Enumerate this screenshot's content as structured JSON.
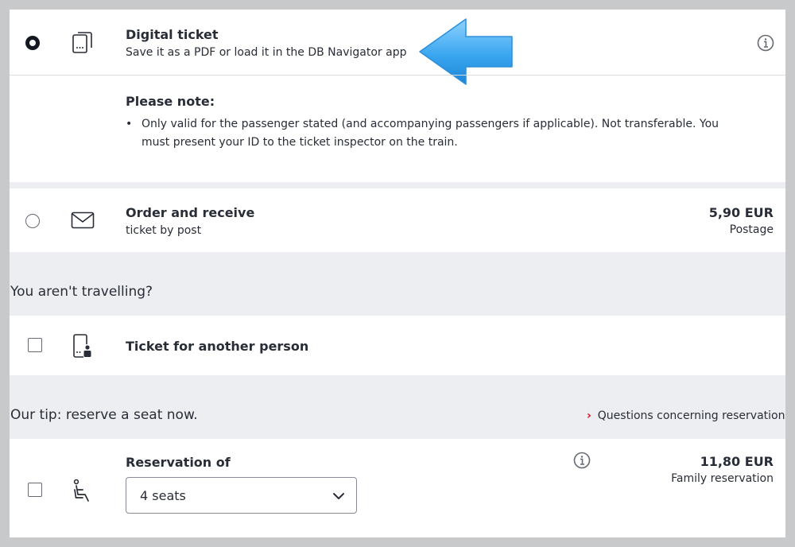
{
  "digital_ticket": {
    "title": "Digital ticket",
    "subtitle": "Save it as a PDF or load it in the DB Navigator app",
    "selected": true,
    "icon": "mobile-ticket-icon"
  },
  "note": {
    "heading": "Please note:",
    "items": [
      "Only valid for the passenger stated (and accompanying passengers if applicable). Not transferable. You must present your ID to the ticket inspector on the train."
    ]
  },
  "post_ticket": {
    "title": "Order and receive",
    "subtitle": "ticket by post",
    "price": "5,90 EUR",
    "price_label": "Postage",
    "selected": false,
    "icon": "envelope-icon"
  },
  "not_travelling": {
    "heading": "You aren't travelling?",
    "option_label": "Ticket for another person",
    "checked": false,
    "icon": "person-phone-icon"
  },
  "seat_tip": {
    "heading": "Our tip: reserve a seat now.",
    "link": "Questions concerning reservation?"
  },
  "reservation": {
    "title": "Reservation of",
    "selected_value": "4 seats",
    "price": "11,80 EUR",
    "price_label": "Family reservation",
    "checked": false,
    "icon": "seat-icon"
  },
  "colors": {
    "arrow": "#3aa6f0",
    "link_chevron": "#ec0016",
    "text": "#282d37"
  }
}
